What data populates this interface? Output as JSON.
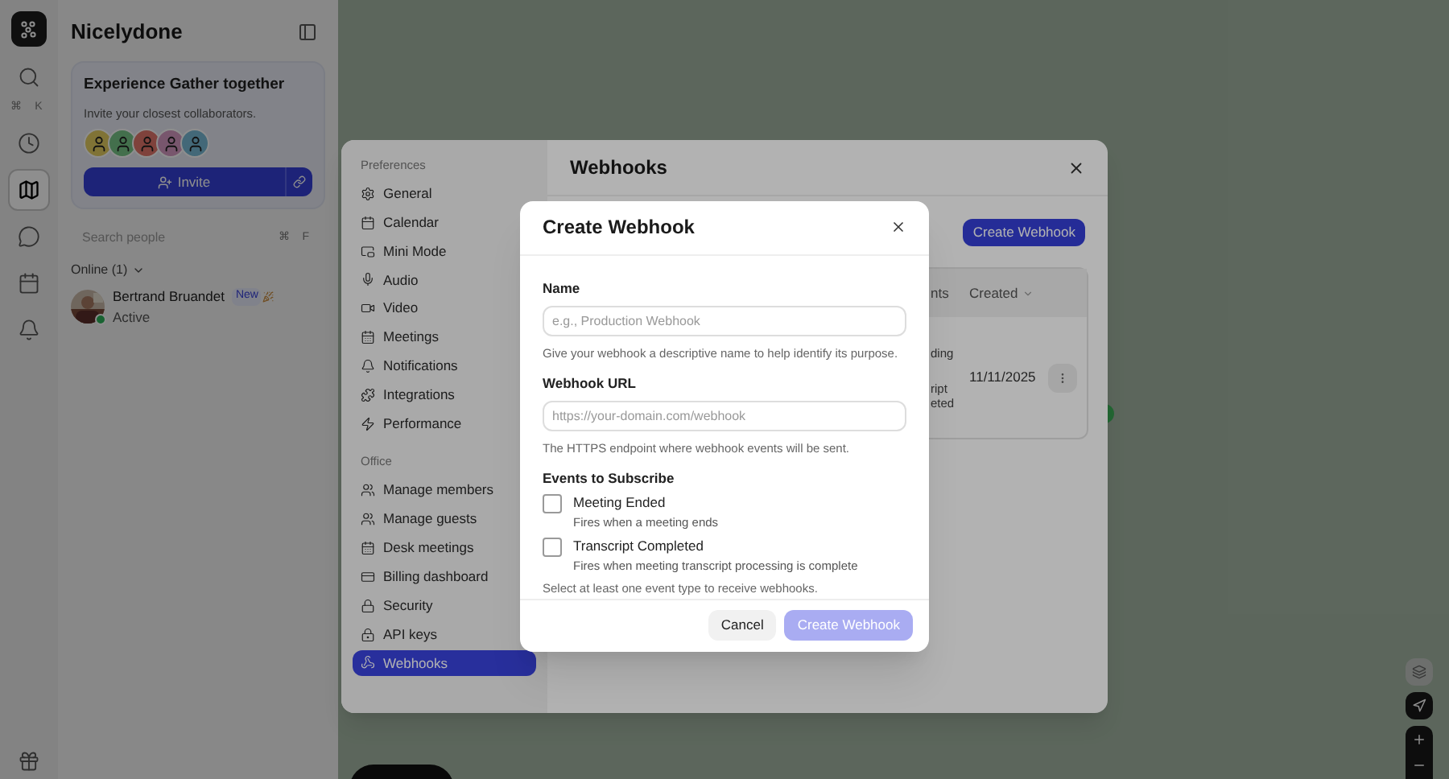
{
  "rail_items": [
    {
      "kind": "search",
      "shortcut": "⌘ K",
      "selected": false
    },
    {
      "kind": "clock",
      "selected": false
    },
    {
      "kind": "map",
      "selected": true
    },
    {
      "kind": "chat",
      "selected": false
    },
    {
      "kind": "calendar",
      "selected": false
    },
    {
      "kind": "bell",
      "selected": false
    },
    {
      "kind": "gift",
      "selected": false
    }
  ],
  "sidebar": {
    "title": "Nicelydone",
    "invite_card": {
      "title": "Experience Gather together",
      "subtitle": "Invite your closest collaborators.",
      "button": "Invite"
    },
    "search": {
      "placeholder": "Search people",
      "shortcut": "⌘ F"
    },
    "online_header": "Online (1)",
    "online_expanded": true,
    "people": [
      {
        "name": "Bertrand Bruandet",
        "badge": "New",
        "status_text": "Active",
        "online": true
      }
    ]
  },
  "settings": {
    "title": "Webhooks",
    "sections": [
      {
        "heading": "Preferences",
        "items": [
          {
            "label": "General",
            "kind": "general",
            "selected": false
          },
          {
            "label": "Calendar",
            "kind": "calendar",
            "selected": false
          },
          {
            "label": "Mini Mode",
            "kind": "mini",
            "selected": false
          },
          {
            "label": "Audio",
            "kind": "audio",
            "selected": false
          },
          {
            "label": "Video",
            "kind": "video",
            "selected": false
          },
          {
            "label": "Meetings",
            "kind": "meetings",
            "selected": false
          },
          {
            "label": "Notifications",
            "kind": "bell",
            "selected": false
          },
          {
            "label": "Integrations",
            "kind": "integrations",
            "selected": false
          },
          {
            "label": "Performance",
            "kind": "performance",
            "selected": false
          }
        ]
      },
      {
        "heading": "Office",
        "items": [
          {
            "label": "Manage members",
            "kind": "members",
            "selected": false
          },
          {
            "label": "Manage guests",
            "kind": "guests",
            "selected": false
          },
          {
            "label": "Desk meetings",
            "kind": "meetings",
            "selected": false
          },
          {
            "label": "Billing dashboard",
            "kind": "billing",
            "selected": false
          },
          {
            "label": "Security",
            "kind": "lock",
            "selected": false
          },
          {
            "label": "API keys",
            "kind": "key",
            "selected": false
          },
          {
            "label": "Webhooks",
            "kind": "webhook",
            "selected": true
          }
        ]
      }
    ],
    "create_button": "Create Webhook",
    "table": {
      "columns": [
        {
          "label": "nts"
        },
        {
          "label": "Created",
          "sortable": true
        }
      ],
      "rows": [
        {
          "column_3": [
            "ding",
            "ript",
            "eted"
          ],
          "created": "11/11/2025"
        }
      ]
    }
  },
  "dialog": {
    "title": "Create Webhook",
    "fields": [
      {
        "label": "Name",
        "placeholder": "e.g., Production Webhook",
        "help": "Give your webhook a descriptive name to help identify its purpose."
      },
      {
        "label": "Webhook URL",
        "placeholder": "https://your-domain.com/webhook",
        "help": "The HTTPS endpoint where webhook events will be sent."
      }
    ],
    "events_heading": "Events to Subscribe",
    "events": [
      {
        "title": "Meeting Ended",
        "description": "Fires when a meeting ends",
        "checked": false
      },
      {
        "title": "Transcript Completed",
        "description": "Fires when meeting transcript processing is complete",
        "checked": false
      }
    ],
    "events_help": "Select at least one event type to receive webhooks.",
    "cancel": "Cancel",
    "submit": {
      "label": "Create Webhook",
      "disabled": true
    }
  }
}
